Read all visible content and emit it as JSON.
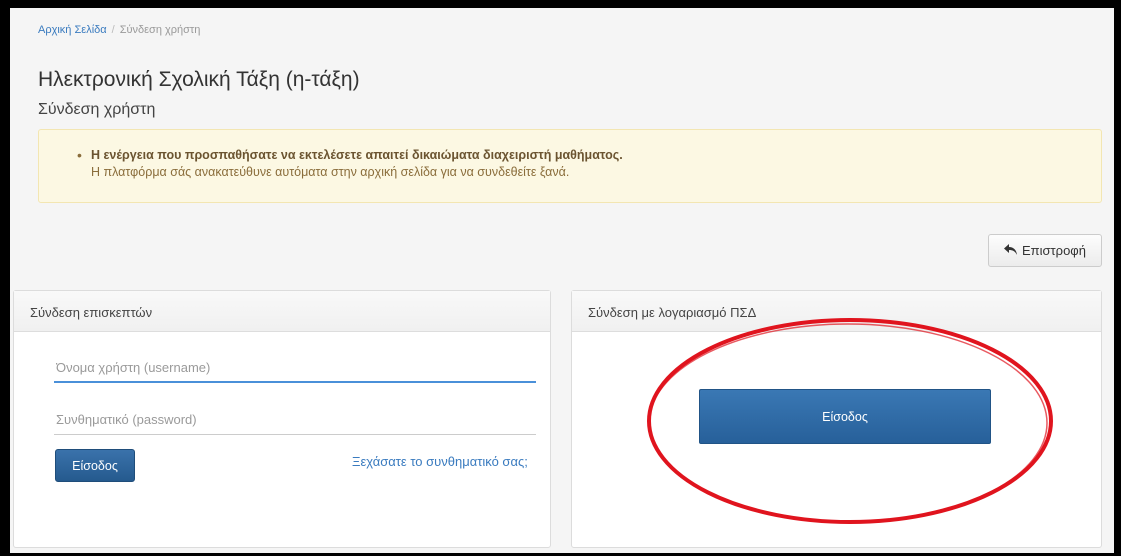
{
  "breadcrumb": {
    "home": "Αρχική Σελίδα",
    "separator": "/",
    "current": "Σύνδεση χρήστη"
  },
  "header": {
    "title": "Ηλεκτρονική Σχολική Τάξη (η-τάξη)",
    "subtitle": "Σύνδεση χρήστη"
  },
  "alert": {
    "bullet": "•",
    "message": "Η ενέργεια που προσπαθήσατε να εκτελέσετε απαιτεί δικαιώματα διαχειριστή μαθήματος.",
    "detail": "Η πλατφόρμα σάς ανακατεύθυνε αυτόματα στην αρχική σελίδα για να συνδεθείτε ξανά."
  },
  "back_button": {
    "label": "Επιστροφή",
    "icon": "reply-arrow-icon"
  },
  "guest_panel": {
    "title": "Σύνδεση επισκεπτών",
    "username_placeholder": "Όνομα χρήστη (username)",
    "password_placeholder": "Συνθηματικό (password)",
    "login_label": "Είσοδος",
    "forgot_label": "Ξεχάσατε το συνθηματικό σας;"
  },
  "psd_panel": {
    "title": "Σύνδεση με λογαριασμό ΠΣΔ",
    "login_label": "Είσοδος"
  },
  "colors": {
    "primary_button": "#2d6aa3",
    "alert_bg": "#fcf8e3",
    "annotation_circle": "#e0141e"
  }
}
